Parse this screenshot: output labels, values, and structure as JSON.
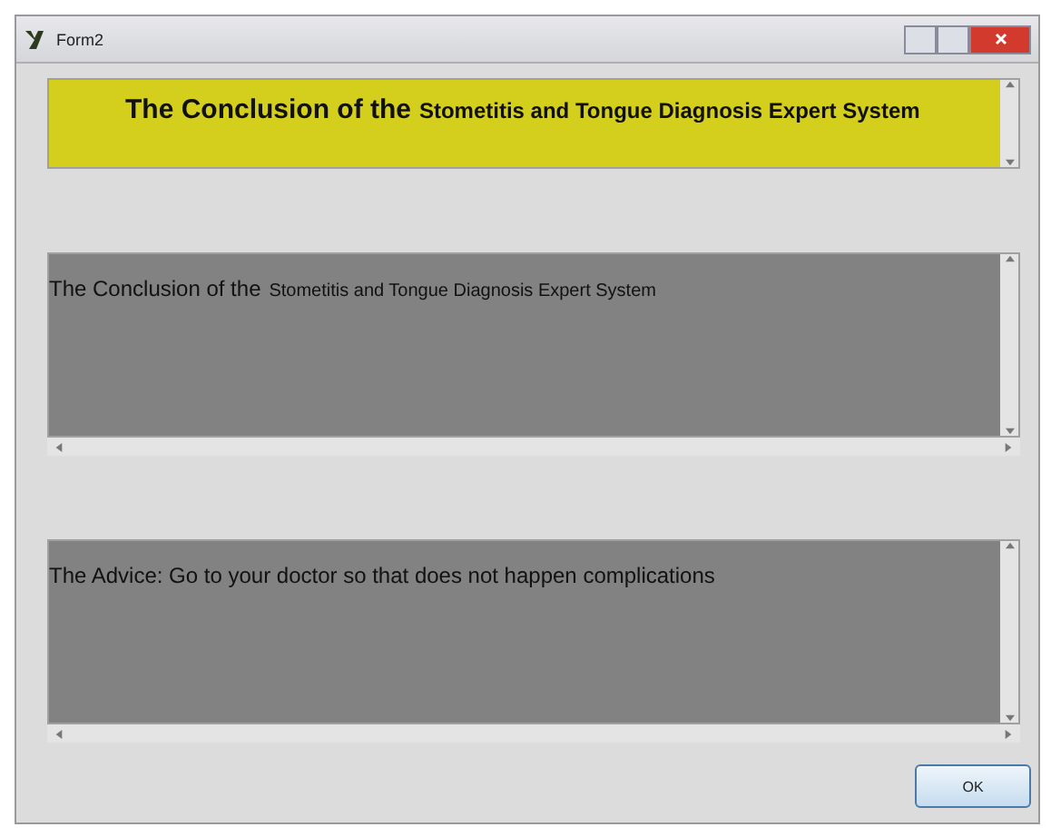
{
  "window": {
    "title": "Form2"
  },
  "boxes": [
    {
      "kind": "banner",
      "lead": "The Conclusion of the",
      "rest": "Stometitis and Tongue Diagnosis Expert System"
    },
    {
      "kind": "result",
      "lead": "The Conclusion of the",
      "rest": "Stometitis and Tongue Diagnosis Expert System"
    },
    {
      "kind": "result",
      "lead": "The Advice: Go to your doctor so that does not happen complications"
    }
  ],
  "buttons": [
    "OK"
  ]
}
